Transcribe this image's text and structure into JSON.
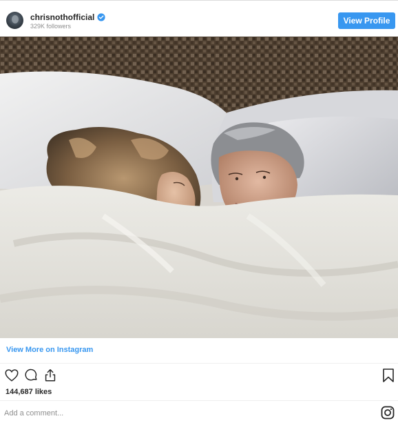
{
  "header": {
    "username": "chrisnothofficial",
    "followers": "329K followers",
    "view_profile_label": "View Profile",
    "verified_icon": "verified-badge-icon",
    "avatar_icon": "profile-avatar"
  },
  "post": {
    "photo_icon": "post-photo"
  },
  "footer": {
    "view_more_label": "View More on Instagram",
    "likes": "144,687 likes",
    "comment_placeholder": "Add a comment...",
    "action_icons": [
      "heart-icon",
      "comment-icon",
      "share-icon",
      "bookmark-icon"
    ],
    "logo_icon": "instagram-icon"
  },
  "colors": {
    "accent": "#3897f0",
    "text": "#262626",
    "muted": "#8e8e8e",
    "divider": "#efefef"
  }
}
